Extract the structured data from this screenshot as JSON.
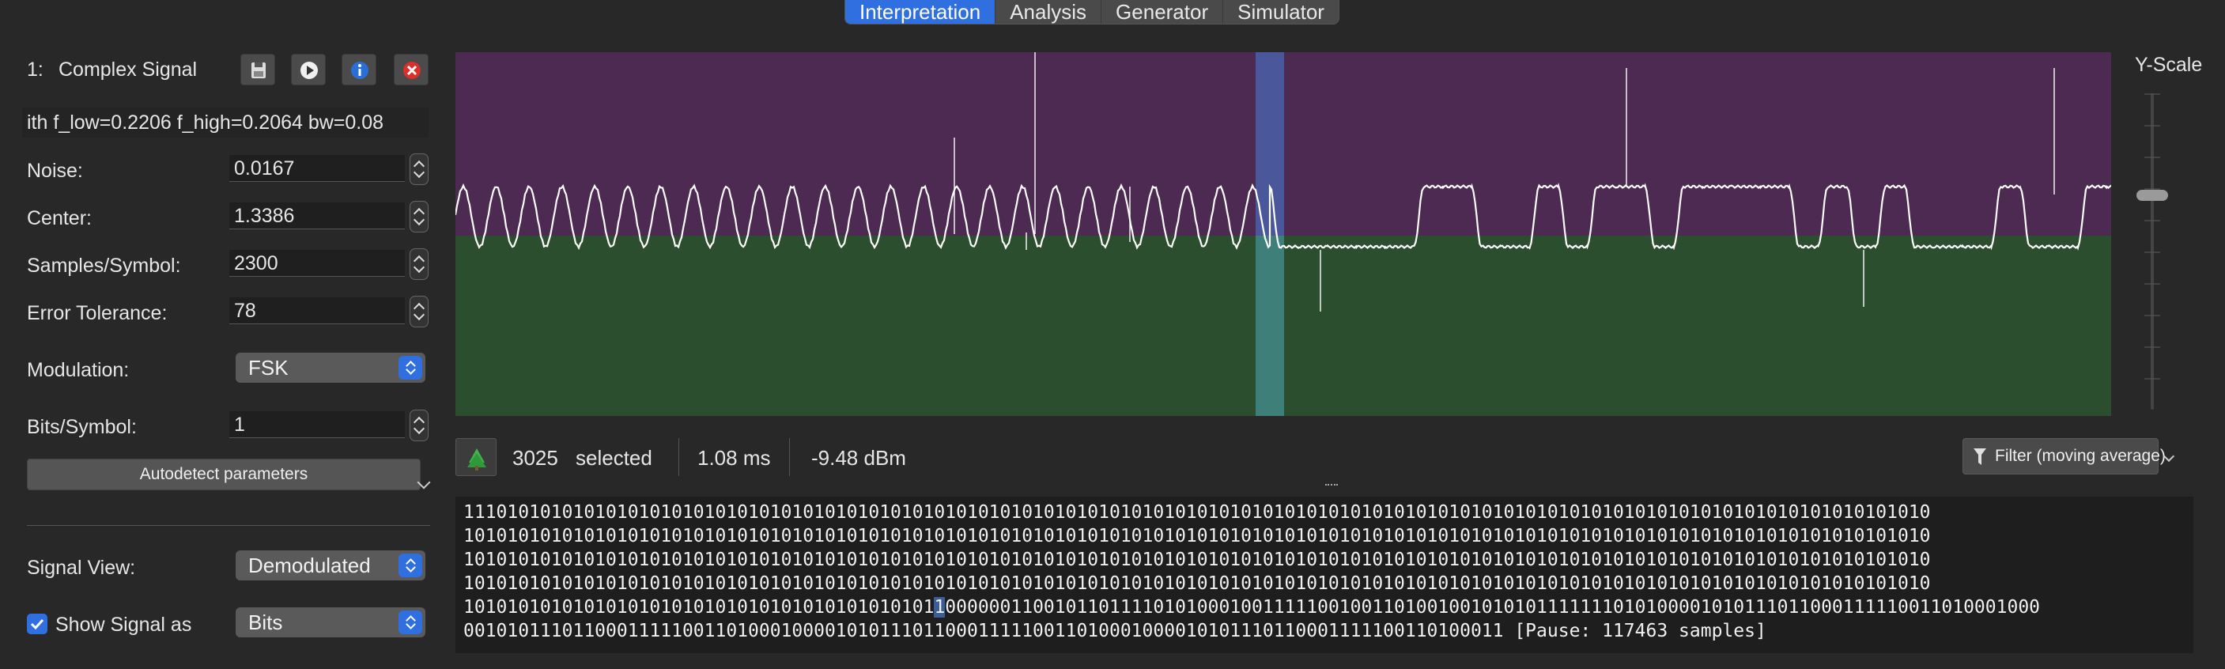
{
  "tabs": [
    {
      "label": "Interpretation",
      "active": true
    },
    {
      "label": "Analysis",
      "active": false
    },
    {
      "label": "Generator",
      "active": false
    },
    {
      "label": "Simulator",
      "active": false
    }
  ],
  "signal": {
    "index": "1:",
    "name": "Complex Signal",
    "info": "ith f_low=0.2206 f_high=0.2064 bw=0.08"
  },
  "params": {
    "noise_label": "Noise:",
    "noise_value": "0.0167",
    "center_label": "Center:",
    "center_value": "1.3386",
    "sps_label": "Samples/Symbol:",
    "sps_value": "2300",
    "tol_label": "Error Tolerance:",
    "tol_value": "78",
    "mod_label": "Modulation:",
    "mod_value": "FSK",
    "bps_label": "Bits/Symbol:",
    "bps_value": "1",
    "autodetect_label": "Autodetect parameters",
    "view_label": "Signal View:",
    "view_value": "Demodulated",
    "show_as_label": "Show Signal as",
    "show_as_value": "Bits",
    "show_as_checked": true
  },
  "plot": {
    "upper_color": "#4d2a52",
    "lower_color": "#2b4f2e",
    "selection_color": "#4b5fa8",
    "yscale_label": "Y-Scale"
  },
  "status": {
    "selected_count": "3025",
    "selected_label": "selected",
    "duration": "1.08 ms",
    "power": "-9.48 dBm",
    "filter_label": "Filter (moving average)"
  },
  "bits": {
    "lines": [
      "11101010101010101010101010101010101010101010101010101010101010101010101010101010101010101010101010101010101010101010101010101010101010",
      "10101010101010101010101010101010101010101010101010101010101010101010101010101010101010101010101010101010101010101010101010101010101010",
      "10101010101010101010101010101010101010101010101010101010101010101010101010101010101010101010101010101010101010101010101010101010101010",
      "10101010101010101010101010101010101010101010101010101010101010101010101010101010101010101010101010101010101010101010101010101010101010"
    ],
    "line5_pre": "1010101010101010101010101010101010101010101",
    "line5_sel": "1",
    "line5_post": "0000001100101101111010100010011111001001101001001010101111111010100001010111011000111110011010001000",
    "line6": "00101011101100011111001101000100001010111011000111110011010001000010101110110001111100110100011 [Pause: 117463 samples]"
  }
}
